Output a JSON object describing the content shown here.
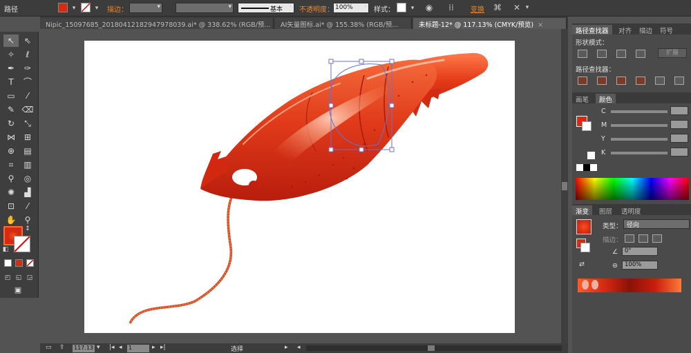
{
  "control_bar": {
    "object_type": "路径",
    "stroke_label": "描边：",
    "stroke_profile": "基本",
    "opacity_label": "不透明度：",
    "opacity_value": "100%",
    "style_label": "样式：",
    "transform_label": "变换"
  },
  "tabs": [
    {
      "label": "Nipic_15097685_20180412182947978039.ai* @ 338.62% (RGB/预...",
      "active": false
    },
    {
      "label": "AI矢量图标.ai* @ 155.38% (RGB/预...",
      "active": false
    },
    {
      "label": "未标题-12* @ 117.13% (CMYK/预览)",
      "active": true
    }
  ],
  "status": {
    "zoom": "117.13",
    "page": "1",
    "mode": "选择"
  },
  "panels": {
    "pathfinder": {
      "tabs": [
        "路径查找器",
        "对齐",
        "描边",
        "符号"
      ],
      "shape_modes_label": "形状模式：",
      "expand_label": "扩展",
      "pathfinders_label": "路径查找器："
    },
    "color": {
      "tabs": [
        "画笔",
        "颜色"
      ],
      "channels": [
        "C",
        "M",
        "Y",
        "K"
      ]
    },
    "gradient": {
      "tabs": [
        "渐变",
        "图层",
        "透明度"
      ],
      "type_label": "类型：",
      "type_value": "径向",
      "stroke_label": "描边：",
      "angle_value": "0°",
      "aspect_value": "100%"
    }
  },
  "colors": {
    "fill": "#d62a12",
    "lobster_dark": "#b81d0c",
    "lobster_mid": "#e03a1a",
    "lobster_light": "#f46a3a",
    "selection": "#6a6fd0"
  }
}
